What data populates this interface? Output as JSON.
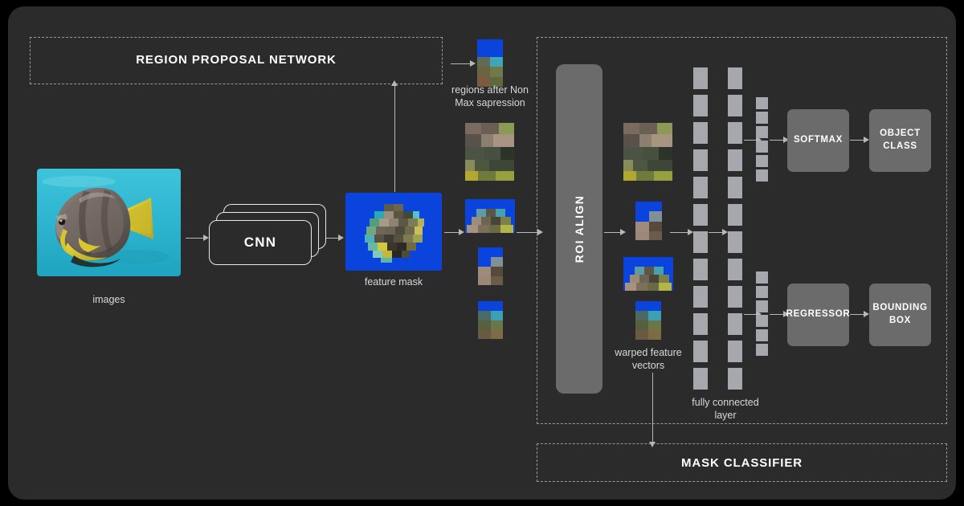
{
  "diagram": {
    "title": "Mask R-CNN architecture",
    "background": "#2b2b2b",
    "outer_background": "#000000",
    "accent_gray": "#6b6b6b",
    "cell_gray": "#a7a7ae",
    "arrow_color": "#b8b8b8",
    "dashed_color": "#9a9a9a",
    "mask_blue": "#0b43dd"
  },
  "panels": {
    "rpn": {
      "title": "REGION PROPOSAL NETWORK"
    },
    "heads": {
      "title": ""
    },
    "mask": {
      "title": "MASK CLASSIFIER"
    }
  },
  "blocks": {
    "cnn": "CNN",
    "roi_align": "ROI ALIGN",
    "softmax": "SOFTMAX",
    "object_class": "OBJECT\nCLASS",
    "object_class_line1": "OBJECT",
    "object_class_line2": "CLASS",
    "regressor": "REGRESSOR",
    "bounding_box_line1": "BOUNDING",
    "bounding_box_line2": "BOX"
  },
  "captions": {
    "images": "images",
    "feature_mask": "feature mask",
    "regions_nms_line1": "regions after Non",
    "regions_nms_line2": "Max sapression",
    "warped_line1": "warped feature",
    "warped_line2": "vectors",
    "fc_line1": "fully connected",
    "fc_line2": "layer"
  },
  "fc_layers": {
    "column_1_cells": 12,
    "column_2_cells": 12,
    "class_branch_cells": 6,
    "box_branch_cells": 6
  },
  "proposals": {
    "count": 4,
    "labels": [
      "proposal-1",
      "proposal-2",
      "proposal-3",
      "proposal-4"
    ]
  },
  "warped": {
    "count": 4,
    "labels": [
      "warped-1",
      "warped-2",
      "warped-3",
      "warped-4"
    ]
  }
}
